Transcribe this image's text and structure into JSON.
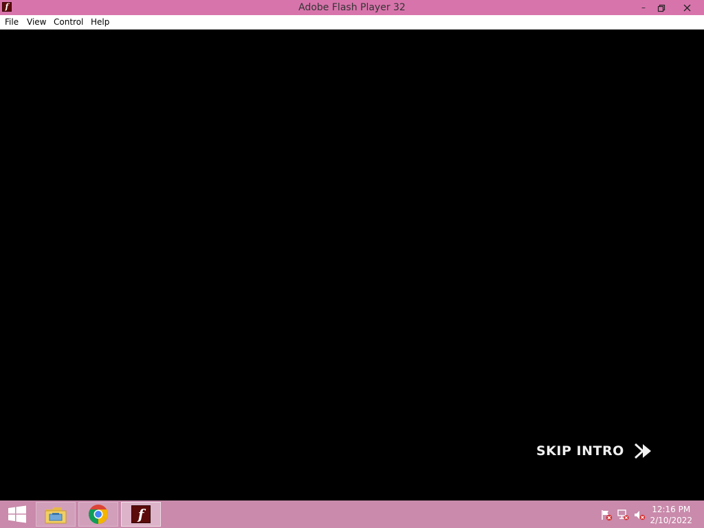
{
  "window": {
    "title": "Adobe Flash Player 32",
    "icon": "flash-player-icon",
    "controls": [
      "minimize-icon",
      "restore-icon",
      "close-icon"
    ]
  },
  "menu": {
    "file": "File",
    "view": "View",
    "control": "Control",
    "help": "Help"
  },
  "stage": {
    "background": "#000000",
    "skip_label": "SKIP INTRO",
    "skip_icon": "fast-forward-icon"
  },
  "taskbar": {
    "background": "#c98aab",
    "start_icon": "windows-start-icon",
    "apps": [
      "file-explorer-icon",
      "chrome-icon",
      "flash-player-icon"
    ],
    "tray_icons": [
      "action-center-flag-icon",
      "network-icon",
      "volume-muted-icon"
    ],
    "time": "12:16 PM",
    "date": "2/10/2022"
  },
  "colors": {
    "titlebar": "#d874ac",
    "flash_red": "#5c0b0b"
  }
}
